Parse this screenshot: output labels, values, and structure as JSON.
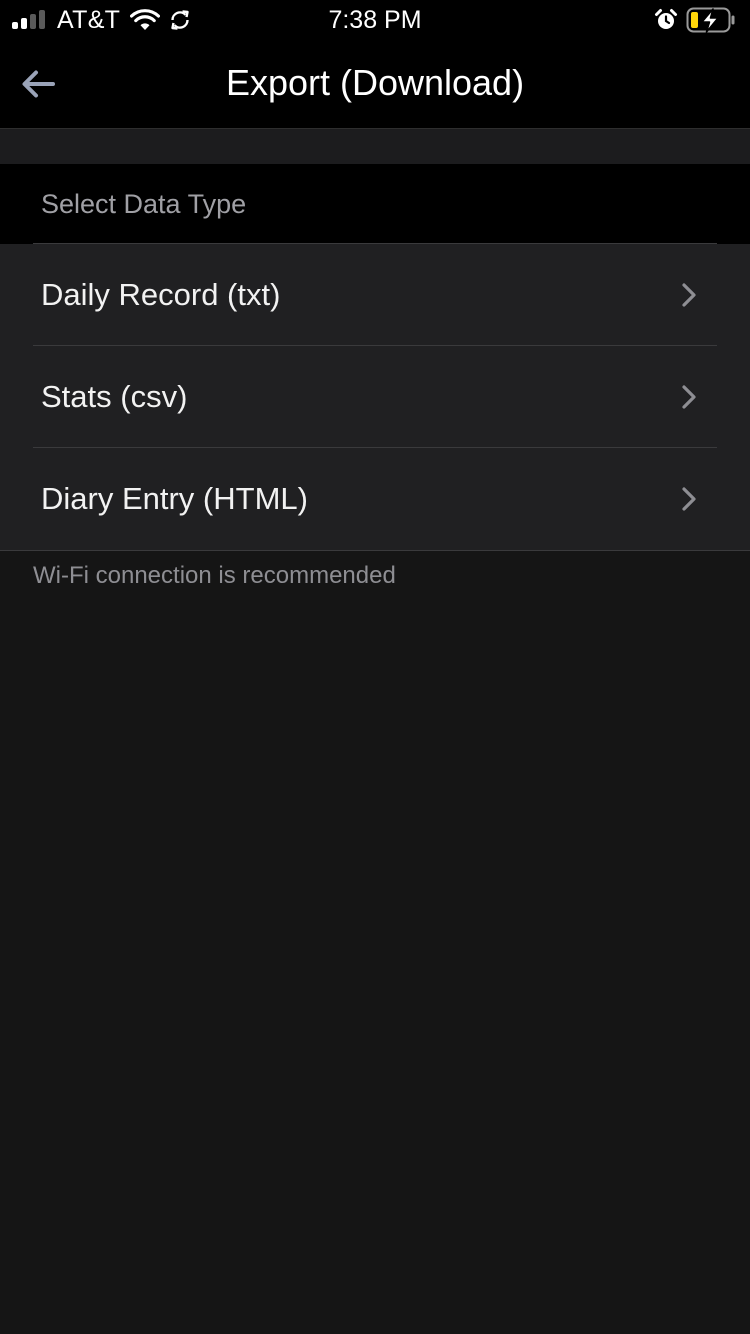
{
  "status_bar": {
    "carrier": "AT&T",
    "time": "7:38 PM",
    "icons": [
      "signal-icon",
      "wifi-icon",
      "sync-icon",
      "alarm-icon",
      "battery-charging-icon"
    ],
    "battery_color": "#ffd60a"
  },
  "nav": {
    "title": "Export (Download)",
    "back_icon": "arrow-left-icon"
  },
  "section": {
    "header": "Select Data Type"
  },
  "items": [
    {
      "label": "Daily Record (txt)",
      "icon": "chevron-right-icon"
    },
    {
      "label": "Stats (csv)",
      "icon": "chevron-right-icon"
    },
    {
      "label": "Diary Entry (HTML)",
      "icon": "chevron-right-icon"
    }
  ],
  "footnote": "Wi-Fi connection is recommended",
  "colors": {
    "background": "#151515",
    "bar": "#000000",
    "cell": "#202022",
    "accent": "#9aa3b8",
    "secondary_text": "#8e8e93"
  }
}
